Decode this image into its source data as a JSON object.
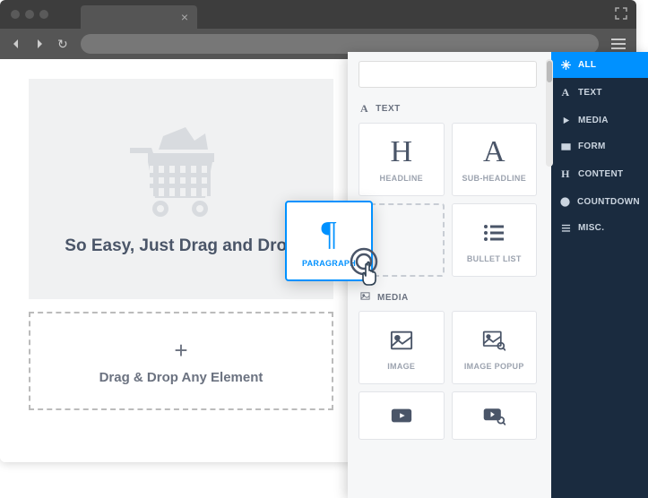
{
  "canvas": {
    "hero_text": "So Easy, Just Drag and Drop",
    "dropzone_plus": "+",
    "dropzone_text": "Drag & Drop Any Element"
  },
  "sections": {
    "text": "TEXT",
    "media": "MEDIA"
  },
  "tiles": {
    "headline": {
      "letter": "H",
      "label": "HEADLINE"
    },
    "subheadline": {
      "letter": "A",
      "label": "SUB-HEADLINE"
    },
    "bulletlist": {
      "label": "BULLET LIST"
    },
    "image": {
      "label": "IMAGE"
    },
    "imagepopup": {
      "label": "IMAGE POPUP"
    }
  },
  "drag": {
    "symbol": "¶",
    "label": "PARAGRAPH"
  },
  "sidebar": [
    {
      "label": "ALL",
      "icon": "snowflake"
    },
    {
      "label": "TEXT",
      "icon": "A"
    },
    {
      "label": "MEDIA",
      "icon": "play"
    },
    {
      "label": "FORM",
      "icon": "mail"
    },
    {
      "label": "CONTENT",
      "icon": "H"
    },
    {
      "label": "COUNTDOWN",
      "icon": "clock"
    },
    {
      "label": "MISC.",
      "icon": "menu"
    }
  ]
}
